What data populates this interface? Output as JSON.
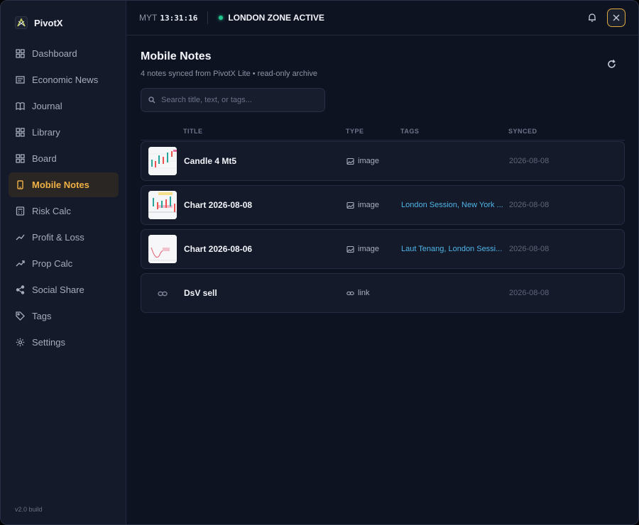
{
  "brand": {
    "name": "PivotX",
    "logo_text": "PX"
  },
  "nav": {
    "items": [
      {
        "label": "Dashboard",
        "icon": "dashboard-icon",
        "active": false
      },
      {
        "label": "Economic News",
        "icon": "news-icon",
        "active": false
      },
      {
        "label": "Journal",
        "icon": "journal-icon",
        "active": false
      },
      {
        "label": "Library",
        "icon": "library-icon",
        "active": false
      },
      {
        "label": "Board",
        "icon": "board-icon",
        "active": false
      },
      {
        "label": "Mobile Notes",
        "icon": "mobile-icon",
        "active": true
      },
      {
        "label": "Risk Calc",
        "icon": "calculator-icon",
        "active": false
      },
      {
        "label": "Profit & Loss",
        "icon": "trend-icon",
        "active": false
      },
      {
        "label": "Prop Calc",
        "icon": "trend-up-icon",
        "active": false
      },
      {
        "label": "Social Share",
        "icon": "share-icon",
        "active": false
      },
      {
        "label": "Tags",
        "icon": "tag-icon",
        "active": false
      },
      {
        "label": "Settings",
        "icon": "gear-icon",
        "active": false
      }
    ]
  },
  "version": "v2.0 build",
  "topbar": {
    "timezone": "MYT",
    "time": "13:31:16",
    "session": "LONDON ZONE ACTIVE"
  },
  "page": {
    "title": "Mobile Notes",
    "subtitle": "4 notes synced from PivotX Lite • read-only archive"
  },
  "search": {
    "placeholder": "Search title, text, or tags..."
  },
  "table": {
    "headers": {
      "title": "TITLE",
      "type": "TYPE",
      "tags": "TAGS",
      "synced": "SYNCED"
    },
    "rows": [
      {
        "title": "Candle 4 Mt5",
        "type": "image",
        "tags": "",
        "synced": "2026-08-08",
        "kind": "image"
      },
      {
        "title": "Chart 2026-08-08",
        "type": "image",
        "tags": "London Session, New York ...",
        "synced": "2026-08-08",
        "kind": "image"
      },
      {
        "title": "Chart 2026-08-06",
        "type": "image",
        "tags": "Laut Tenang, London Sessi...",
        "synced": "2026-08-08",
        "kind": "image"
      },
      {
        "title": "DsV sell",
        "type": "link",
        "tags": "",
        "synced": "2026-08-08",
        "kind": "link"
      }
    ]
  },
  "colors": {
    "accent": "#f0b145",
    "active_bg": "#2a2624",
    "status_green": "#22c58b",
    "tag_blue": "#4fb5e8",
    "background": "#0e1322",
    "sidebar": "#141a2a"
  }
}
